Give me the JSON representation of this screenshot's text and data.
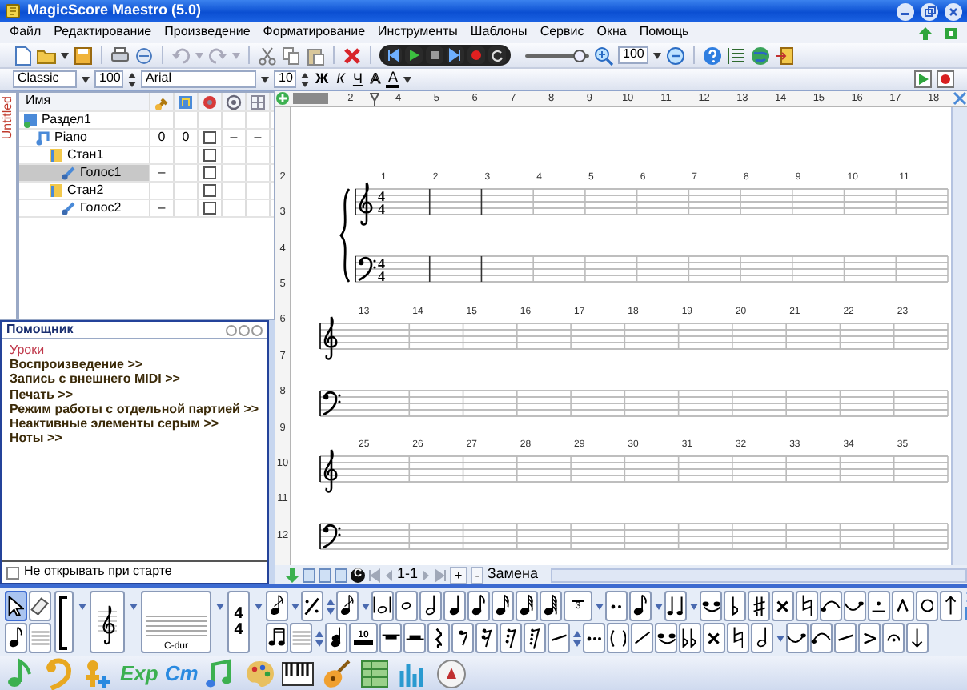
{
  "window": {
    "title": "MagicScore Maestro (5.0)"
  },
  "menu": [
    "Файл",
    "Редактирование",
    "Произведение",
    "Форматирование",
    "Инструменты",
    "Шаблоны",
    "Сервис",
    "Окна",
    "Помощь"
  ],
  "toolbar": {
    "zoom_slider": {
      "level": 0.85
    },
    "zoom_value": "100"
  },
  "format_bar": {
    "style": "Classic",
    "scale": "100",
    "font": "Arial",
    "font_size": "10",
    "buttons": [
      {
        "label": "Ж",
        "kind": "bold"
      },
      {
        "label": "К",
        "kind": "italic"
      },
      {
        "label": "Ч",
        "kind": "underline"
      },
      {
        "label": "А",
        "kind": "outline"
      },
      {
        "label": "А",
        "kind": "color"
      }
    ]
  },
  "document_tab": {
    "label": "Untitled",
    "selected": true
  },
  "tree": {
    "name_column": "Имя",
    "nodes": [
      {
        "name": "Раздел1",
        "kind": "section",
        "selected": false,
        "children": [
          {
            "name": "Piano",
            "kind": "instrument",
            "selected": false,
            "cells": {
              "column_2": "0",
              "column_3": "0",
              "column_5": "–",
              "column_6": "–"
            },
            "checked": false,
            "children": [
              {
                "name": "Стан1",
                "kind": "staff",
                "selected": false,
                "checked": false,
                "children": [
                  {
                    "name": "Голос1",
                    "kind": "voice",
                    "selected": true,
                    "cells": {
                      "column_2": "–"
                    },
                    "checked": false
                  }
                ]
              },
              {
                "name": "Стан2",
                "kind": "staff",
                "selected": false,
                "checked": false,
                "children": [
                  {
                    "name": "Голос2",
                    "kind": "voice",
                    "selected": false,
                    "cells": {
                      "column_2": "–"
                    },
                    "checked": false
                  }
                ]
              }
            ]
          }
        ]
      }
    ]
  },
  "helper": {
    "title": "Помощник",
    "links": [
      {
        "label": "Уроки",
        "selected": true
      },
      {
        "label": "Воспроизведение >>",
        "selected": false
      },
      {
        "label": "Запись с внешнего MIDI >>",
        "selected": false
      },
      {
        "label": "Печать >>",
        "selected": false
      },
      {
        "label": "Режим работы с отдельной партией >>",
        "selected": false
      },
      {
        "label": "Неактивные элементы серым >>",
        "selected": false
      },
      {
        "label": "Ноты >>",
        "selected": false
      }
    ],
    "dont_show_at_startup": {
      "label": "Не открывать при старте",
      "checked": false
    }
  },
  "ruler": {
    "labels": [
      "2",
      "4",
      "5",
      "6",
      "7",
      "8",
      "9",
      "10",
      "11",
      "12",
      "13",
      "14",
      "15",
      "16",
      "17",
      "18"
    ]
  },
  "vertical_ruler": {
    "labels": [
      "2",
      "3",
      "4",
      "5",
      "6",
      "7",
      "8",
      "9",
      "10",
      "11",
      "12"
    ]
  },
  "score": {
    "systems": [
      {
        "braced": true,
        "time_signatures": [
          {
            "upper": "4",
            "lower": "4"
          },
          {
            "upper": "4",
            "lower": "4"
          }
        ],
        "measure_numbers": [
          "1",
          "2",
          "3",
          "4",
          "5",
          "6",
          "7",
          "8",
          "9",
          "10",
          "11"
        ]
      },
      {
        "braced": false,
        "measure_numbers": [
          "13",
          "14",
          "15",
          "16",
          "17",
          "18",
          "19",
          "20",
          "21",
          "22",
          "23"
        ]
      },
      {
        "braced": false,
        "measure_numbers": [
          "25",
          "26",
          "27",
          "28",
          "29",
          "30",
          "31",
          "32",
          "33",
          "34",
          "35"
        ]
      }
    ]
  },
  "navigator": {
    "clef_badge": "C",
    "page": "1-1",
    "add": "+",
    "remove": "-",
    "mode": "Замена"
  },
  "palette": {
    "pointer_tool": {
      "selected": true
    },
    "key_signature": "C-dur",
    "time_signature": [
      "4",
      "4"
    ],
    "tuplet": "3",
    "multirest": "10"
  },
  "launcher": {
    "labels": [
      "Exp",
      "Cm"
    ]
  }
}
